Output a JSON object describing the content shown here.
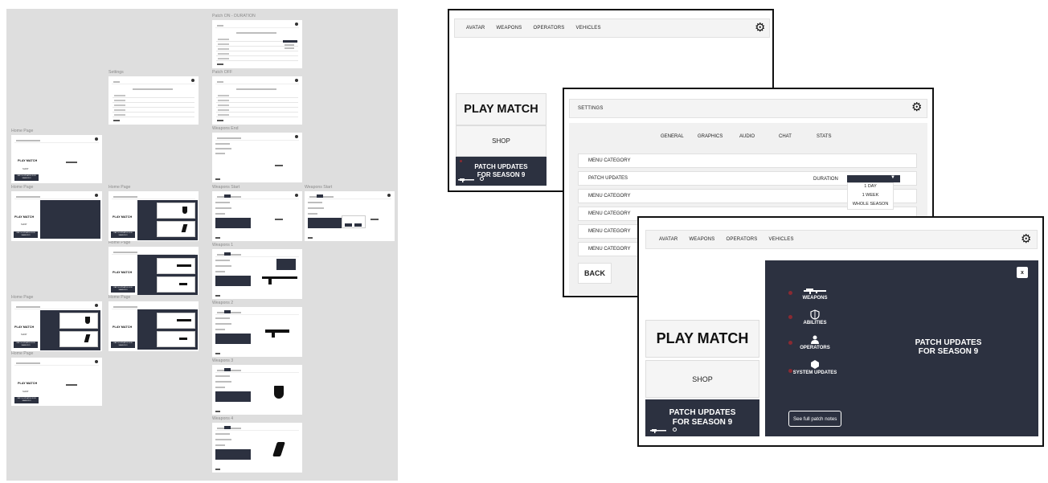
{
  "canvas": {
    "labels": {
      "home1": "Home Page",
      "home2": "Home Page",
      "home3": "Home Page",
      "home4": "Home Page",
      "home5": "Home Page",
      "home6": "Home Page",
      "home7": "Home Page",
      "home8": "Home Page",
      "settings": "Settings",
      "patch_on": "Patch ON - DURATION",
      "patch_off": "Patch OFF",
      "weapons_end": "Weapons End",
      "weapons_start1": "Weapons Start",
      "weapons_start2": "Weapons Start",
      "weapons1": "Weapons 1",
      "weapons2": "Weapons 2",
      "weapons3": "Weapons 3",
      "weapons4": "Weapons 4"
    },
    "mini": {
      "play_match": "PLAY MATCH",
      "shop": "SHOP",
      "patch": "PATCH UPDATES FOR SEASON 9",
      "back": "BACK",
      "primary": "PRIMARY WEAPONS",
      "secondary": "SECONDARY WEAPONS",
      "abilities": "ABILITIES"
    }
  },
  "home_window": {
    "nav": [
      "AVATAR",
      "WEAPONS",
      "OPERATORS",
      "VEHICLES"
    ],
    "play_match": "PLAY MATCH",
    "shop": "SHOP",
    "patch_line1": "PATCH UPDATES",
    "patch_line2": "FOR SEASON 9"
  },
  "settings_window": {
    "title": "SETTINGS",
    "tabs": [
      "GENERAL",
      "GRAPHICS",
      "AUDIO",
      "CHAT",
      "STATS"
    ],
    "rows": [
      "MENU CATEGORY",
      "PATCH UPDATES",
      "MENU CATEGORY",
      "MENU CATEGORY",
      "MENU CATEGORY",
      "MENU CATEGORY"
    ],
    "duration_label": "DURATION",
    "duration_options": [
      "1 DAY",
      "1 WEEK",
      "WHOLE SEASON"
    ],
    "back": "BACK"
  },
  "patch_window": {
    "nav": [
      "AVATAR",
      "WEAPONS",
      "OPERATORS",
      "VEHICLES"
    ],
    "play_match": "PLAY MATCH",
    "shop": "SHOP",
    "patch_line1": "PATCH UPDATES",
    "patch_line2": "FOR SEASON 9",
    "close": "x",
    "sidebar": [
      {
        "label": "WEAPONS",
        "icon": "rifle-icon"
      },
      {
        "label": "ABILITIES",
        "icon": "shield-icon"
      },
      {
        "label": "OPERATORS",
        "icon": "person-icon"
      },
      {
        "label": "SYSTEM UPDATES",
        "icon": "hexagon-icon"
      }
    ],
    "title_line1": "PATCH UPDATES",
    "title_line2": "FOR SEASON 9",
    "notes_button": "See full patch notes"
  },
  "colors": {
    "dark_panel": "#2c3140",
    "canvas_bg": "#dedede",
    "accent_dot": "#8a2a32"
  }
}
